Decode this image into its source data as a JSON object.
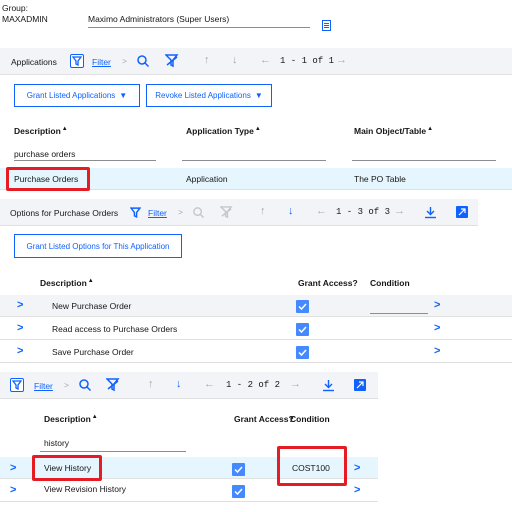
{
  "group": {
    "label": "Group:",
    "name": "MAXADMIN",
    "description": "Maximo Administrators (Super Users)"
  },
  "applications_table": {
    "title": "Applications",
    "filter_label": "Filter",
    "pagination": "1 - 1 of 1",
    "grant_button": "Grant Listed Applications",
    "revoke_button": "Revoke Listed Applications",
    "columns": [
      "Description",
      "Application Type",
      "Main Object/Table"
    ],
    "filter_value": "purchase orders",
    "rows": [
      {
        "description": "Purchase Orders",
        "type": "Application",
        "object": "The PO Table"
      }
    ]
  },
  "options_table": {
    "title": "Options for Purchase Orders",
    "filter_label": "Filter",
    "pagination": "1 - 3 of 3",
    "grant_button": "Grant Listed Options for This Application",
    "columns": [
      "Description",
      "Grant Access?",
      "Condition"
    ],
    "rows": [
      {
        "description": "New Purchase Order",
        "granted": true
      },
      {
        "description": "Read access to Purchase Orders",
        "granted": true
      },
      {
        "description": "Save Purchase Order",
        "granted": true
      }
    ]
  },
  "history_table": {
    "filter_label": "Filter",
    "pagination": "1 - 2 of 2",
    "columns": [
      "Description",
      "Grant Access?",
      "Condition"
    ],
    "filter_value": "history",
    "rows": [
      {
        "description": "View History",
        "granted": true,
        "condition": "COST100"
      },
      {
        "description": "View Revision History",
        "granted": true,
        "condition": ""
      }
    ]
  },
  "colors": {
    "accent": "#0f62fe",
    "highlight": "#e51c23",
    "selected_row": "#e5f6ff",
    "checkbox": "#4589ff"
  }
}
